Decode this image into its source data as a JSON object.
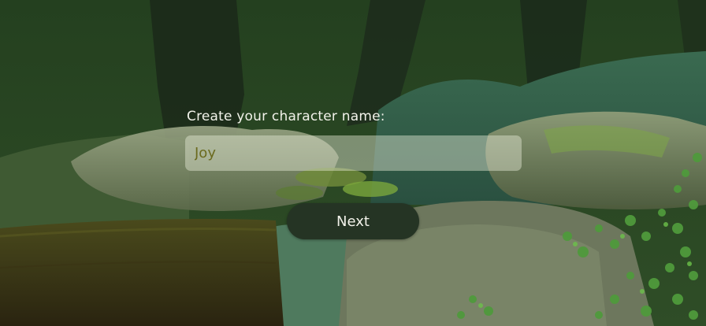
{
  "form": {
    "label": "Create your character name:",
    "name_value": "Joy",
    "next_label": "Next"
  },
  "colors": {
    "button_bg": "#253424",
    "input_text": "#6b6a1e",
    "label_text": "#f2f2ea"
  }
}
